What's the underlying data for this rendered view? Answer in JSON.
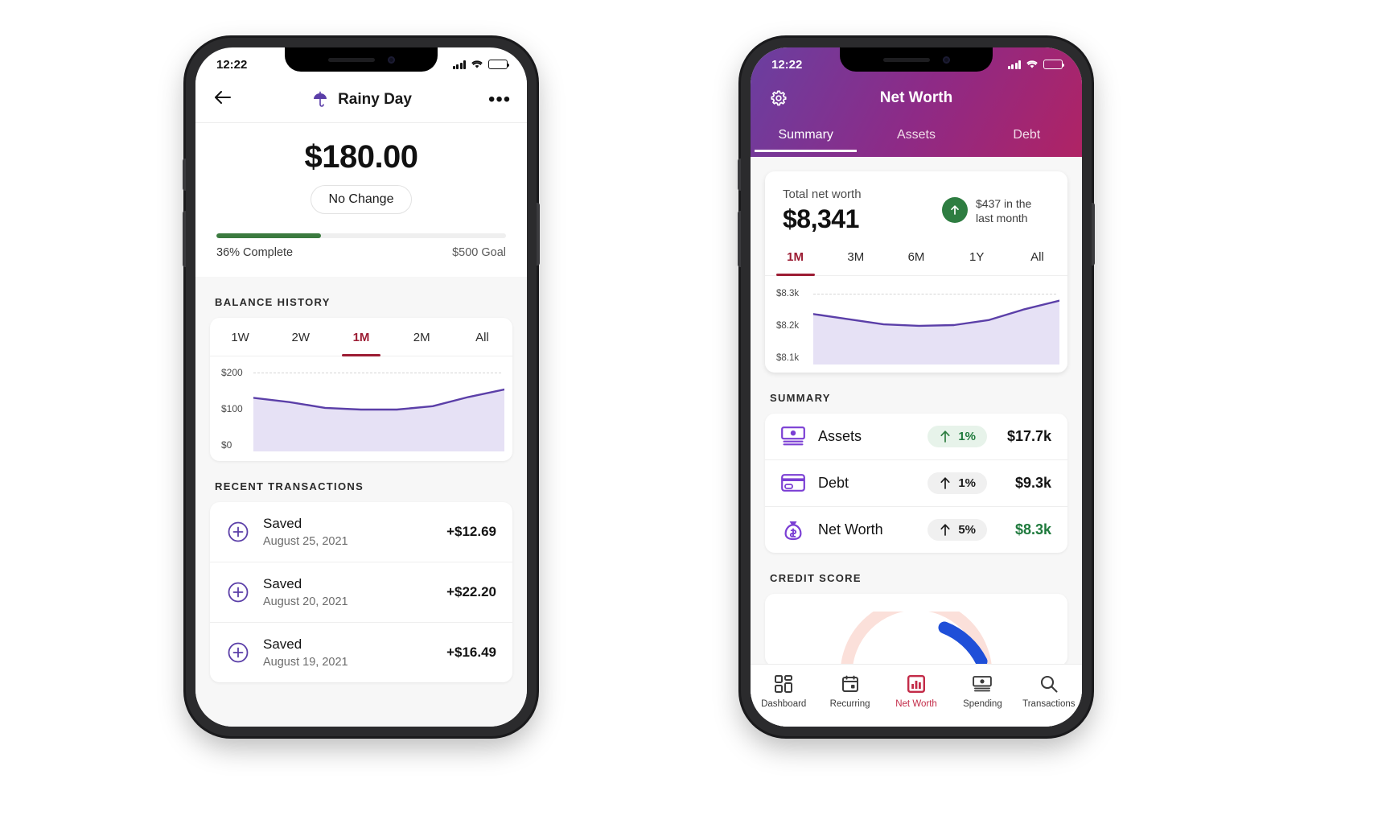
{
  "theme": {
    "accent_purple": "#5b3fa8",
    "accent_crimson": "#9c1c33",
    "tab_active_red": "#c32b48",
    "green": "#2e7d41",
    "green_light": "#e7f3ea",
    "header_gradient_from": "#6a3fa0",
    "header_gradient_to": "#b5225f",
    "area_fill": "#e6e1f5"
  },
  "left_phone": {
    "status": {
      "time": "12:22",
      "signal_icon": "cellular-bars-icon",
      "wifi_icon": "wifi-icon",
      "battery_icon": "battery-icon"
    },
    "nav": {
      "back_icon": "back-arrow-icon",
      "title": "Rainy Day",
      "title_icon": "umbrella-icon",
      "more_icon": "more-options-icon",
      "more_label": "•••"
    },
    "hero": {
      "amount": "$180.00",
      "change_pill": "No Change",
      "progress_percent": 36,
      "progress_label": "36% Complete",
      "goal_label": "$500 Goal"
    },
    "balance_history": {
      "section_title": "BALANCE HISTORY",
      "ranges": [
        "1W",
        "2W",
        "1M",
        "2M",
        "All"
      ],
      "active_range": "1M"
    },
    "transactions": {
      "section_title": "RECENT TRANSACTIONS",
      "items": [
        {
          "icon": "plus-circle-icon",
          "title": "Saved",
          "date": "August 25, 2021",
          "amount": "+$12.69"
        },
        {
          "icon": "plus-circle-icon",
          "title": "Saved",
          "date": "August 20, 2021",
          "amount": "+$22.20"
        },
        {
          "icon": "plus-circle-icon",
          "title": "Saved",
          "date": "August 19, 2021",
          "amount": "+$16.49"
        }
      ]
    }
  },
  "right_phone": {
    "status": {
      "time": "12:22",
      "signal_icon": "cellular-bars-icon",
      "wifi_icon": "wifi-icon",
      "battery_icon": "battery-icon"
    },
    "nav": {
      "settings_icon": "gear-icon",
      "title": "Net Worth"
    },
    "tabs": [
      {
        "label": "Summary",
        "active": true
      },
      {
        "label": "Assets",
        "active": false
      },
      {
        "label": "Debt",
        "active": false
      }
    ],
    "net_worth_card": {
      "label": "Total net worth",
      "value": "$8,341",
      "delta_icon": "arrow-up-circle-icon",
      "delta_text": "$437 in the last month",
      "ranges": [
        "1M",
        "3M",
        "6M",
        "1Y",
        "All"
      ],
      "active_range": "1M"
    },
    "summary": {
      "section_title": "SUMMARY",
      "rows": [
        {
          "icon": "cash-icon",
          "name": "Assets",
          "trend_icon": "arrow-up-icon",
          "change": "1%",
          "value": "$17.7k",
          "badge_style": "green",
          "value_style": "default"
        },
        {
          "icon": "credit-card-icon",
          "name": "Debt",
          "trend_icon": "arrow-up-icon",
          "change": "1%",
          "value": "$9.3k",
          "badge_style": "grey",
          "value_style": "default"
        },
        {
          "icon": "money-bag-icon",
          "name": "Net Worth",
          "trend_icon": "arrow-up-icon",
          "change": "5%",
          "value": "$8.3k",
          "badge_style": "grey",
          "value_style": "green"
        }
      ]
    },
    "credit_score": {
      "section_title": "CREDIT SCORE"
    },
    "tabbar": [
      {
        "icon": "dashboard-grid-icon",
        "label": "Dashboard",
        "active": false
      },
      {
        "icon": "calendar-icon",
        "label": "Recurring",
        "active": false
      },
      {
        "icon": "bar-chart-icon",
        "label": "Net Worth",
        "active": true
      },
      {
        "icon": "cash-icon",
        "label": "Spending",
        "active": false
      },
      {
        "icon": "search-icon",
        "label": "Transactions",
        "active": false
      }
    ]
  },
  "chart_data": [
    {
      "type": "area",
      "title": "Balance History",
      "id": "left-balance-history",
      "xlabel": "",
      "ylabel": "",
      "ytick_labels": [
        "$200",
        "$100",
        "$0"
      ],
      "ylim": [
        0,
        200
      ],
      "grid": true,
      "legend": "none",
      "x": [
        0,
        1,
        2,
        3,
        4,
        5,
        6,
        7
      ],
      "values": [
        128,
        118,
        104,
        100,
        100,
        108,
        130,
        148
      ],
      "line_color": "#5b3fa8",
      "fill_color": "#e6e1f5"
    },
    {
      "type": "area",
      "title": "Net Worth Trend",
      "id": "right-net-worth",
      "xlabel": "",
      "ylabel": "",
      "ytick_labels": [
        "$8.3k",
        "$8.2k",
        "$8.1k"
      ],
      "ylim": [
        8100,
        8300
      ],
      "grid": true,
      "legend": "none",
      "x": [
        0,
        1,
        2,
        3,
        4,
        5,
        6,
        7
      ],
      "values": [
        8228,
        8215,
        8202,
        8198,
        8200,
        8213,
        8240,
        8262
      ],
      "line_color": "#5b3fa8",
      "fill_color": "#e6e1f5"
    }
  ]
}
